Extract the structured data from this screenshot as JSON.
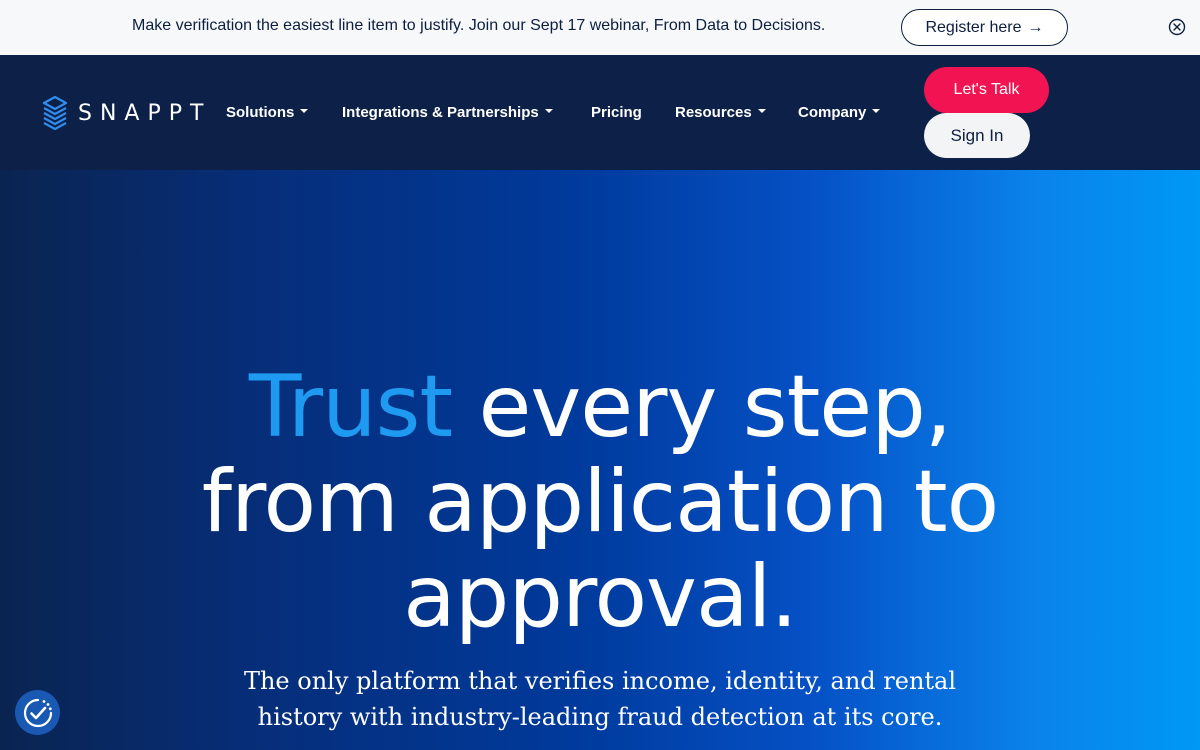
{
  "announcement": {
    "text": "Make verification the easiest line item to justify. Join our Sept 17 webinar, From Data to Decisions.",
    "cta_label": "Register here",
    "cta_arrow": "→",
    "close_icon": "close-circle-icon"
  },
  "nav": {
    "logo_text": "SNAPPT",
    "items": [
      {
        "label": "Solutions",
        "dropdown": true
      },
      {
        "label": "Integrations & Partnerships",
        "dropdown": true
      },
      {
        "label": "Pricing",
        "dropdown": false
      },
      {
        "label": "Resources",
        "dropdown": true
      },
      {
        "label": "Company",
        "dropdown": true
      }
    ],
    "talk_label": "Let's Talk",
    "signin_label": "Sign In"
  },
  "hero": {
    "headline_accent": "Trust",
    "headline_line1_rest": " every step,",
    "headline_line2": "from application to",
    "headline_line3": "approval.",
    "subhead_line1": "The only platform that verifies income, identity, and rental",
    "subhead_line2": "history with industry-leading fraud detection at its core."
  },
  "colors": {
    "accent_blue": "#1e9bf0",
    "cta_red": "#f21452",
    "navy": "#0d2148"
  },
  "accessibility_icon": "accessibility-check-icon"
}
